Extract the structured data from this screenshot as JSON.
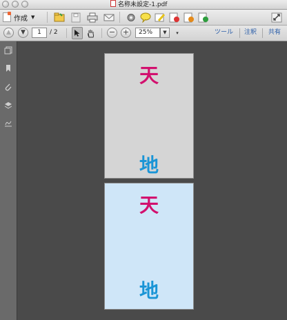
{
  "window": {
    "title": "名称未設定-1.pdf"
  },
  "toolbar": {
    "create_label": "作成",
    "icons": [
      "open-folder-icon",
      "save-icon",
      "print-icon",
      "email-icon",
      "gear-icon",
      "comment-icon",
      "highlight-icon",
      "stamp-icon",
      "attach-icon",
      "export-icon",
      "fullscreen-icon"
    ]
  },
  "nav": {
    "current_page": "1",
    "total_pages": "/ 2",
    "zoom": "25%",
    "links": {
      "tools": "ツール",
      "comment": "注釈",
      "share": "共有"
    }
  },
  "document": {
    "pages": [
      {
        "top": "天",
        "bottom": "地",
        "bg": "#d5d5d5"
      },
      {
        "top": "天",
        "bottom": "地",
        "bg": "#cfe6f8"
      }
    ],
    "colors": {
      "top_text": "#d2106e",
      "bottom_text": "#1a95d6"
    }
  }
}
